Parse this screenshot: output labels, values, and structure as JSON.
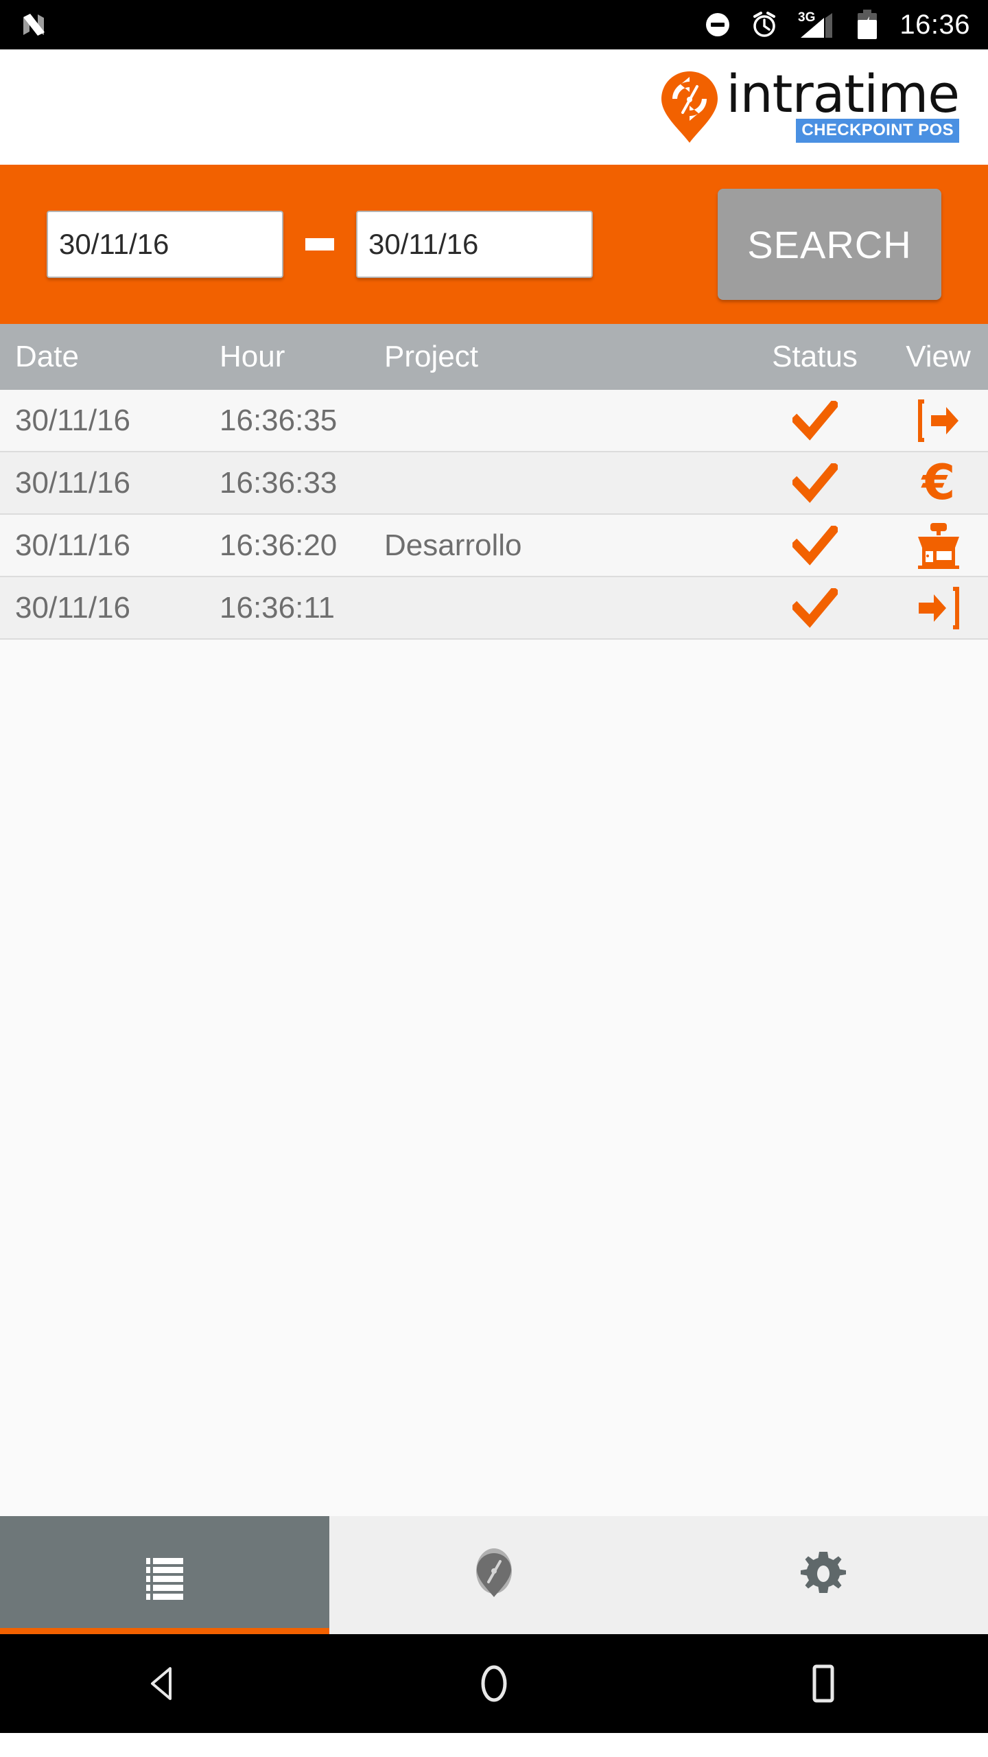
{
  "status_bar": {
    "nfc_icon": "nfc-icon",
    "dnd_icon": "do-not-disturb-icon",
    "alarm_icon": "alarm-clock-icon",
    "network_label": "3G",
    "signal_icon": "signal-bars-icon",
    "battery_icon": "battery-charging-icon",
    "time": "16:36"
  },
  "brand": {
    "name": "intratime",
    "badge": "CHECKPOINT POS",
    "logo_icon": "intratime-pin-logo",
    "badge_color": "#4a90e2",
    "accent_color": "#f26100"
  },
  "search": {
    "date_from": "30/11/16",
    "date_to": "30/11/16",
    "date_from_placeholder": "30/11/16",
    "date_to_placeholder": "30/11/16",
    "separator": "-",
    "button_label": "SEARCH",
    "button_color": "#9e9e9e"
  },
  "table": {
    "headers": {
      "date": "Date",
      "hour": "Hour",
      "project": "Project",
      "status": "Status",
      "view": "View"
    },
    "rows": [
      {
        "date": "30/11/16",
        "hour": "16:36:35",
        "project": "",
        "status_icon": "check-icon",
        "view_icon": "clock-out-icon"
      },
      {
        "date": "30/11/16",
        "hour": "16:36:33",
        "project": "",
        "status_icon": "check-icon",
        "view_icon": "euro-icon"
      },
      {
        "date": "30/11/16",
        "hour": "16:36:20",
        "project": "Desarrollo",
        "status_icon": "check-icon",
        "view_icon": "shop-icon"
      },
      {
        "date": "30/11/16",
        "hour": "16:36:11",
        "project": "",
        "status_icon": "check-icon",
        "view_icon": "clock-in-icon"
      }
    ]
  },
  "tabs": [
    {
      "name": "list-tab",
      "icon": "list-icon",
      "active": true
    },
    {
      "name": "checkpoint-tab",
      "icon": "pin-logo-icon",
      "active": false
    },
    {
      "name": "settings-tab",
      "icon": "gear-icon",
      "active": false
    }
  ],
  "nav_bar": {
    "back": "back-icon",
    "home": "home-icon",
    "recents": "recents-icon"
  }
}
